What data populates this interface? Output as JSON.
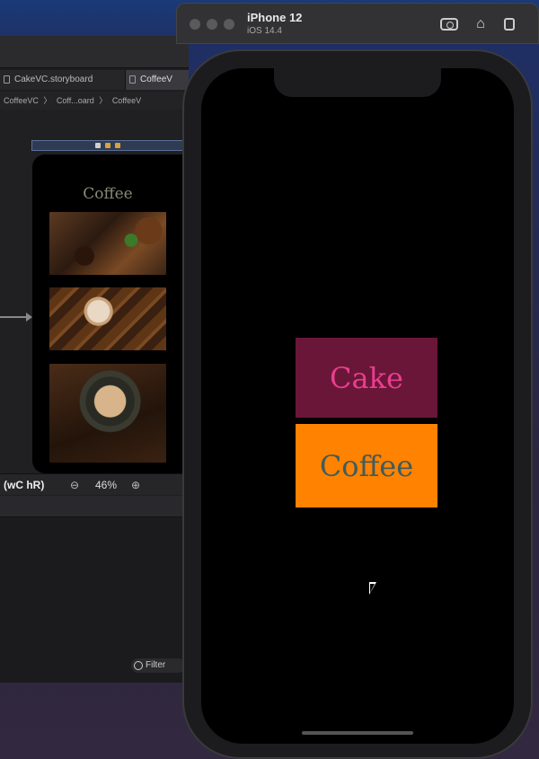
{
  "simulator": {
    "device": "iPhone 12",
    "os": "iOS 14.4"
  },
  "xcode": {
    "tabs": [
      {
        "label": "CakeVC.storyboard"
      },
      {
        "label": "CoffeeV"
      }
    ],
    "breadcrumbs": [
      "CoffeeVC",
      "〉",
      "Coff...oard",
      "〉",
      "CoffeeV"
    ],
    "scene_title": "Coffee",
    "size_class": "(wC hR)",
    "zoom": "46%",
    "filter_placeholder": "Filter"
  },
  "app": {
    "buttons": [
      {
        "label": "Cake",
        "bg": "#6a1638",
        "color": "#ea3d8f"
      },
      {
        "label": "Coffee",
        "bg": "#ff8200",
        "color": "#3f5c5c"
      }
    ]
  }
}
